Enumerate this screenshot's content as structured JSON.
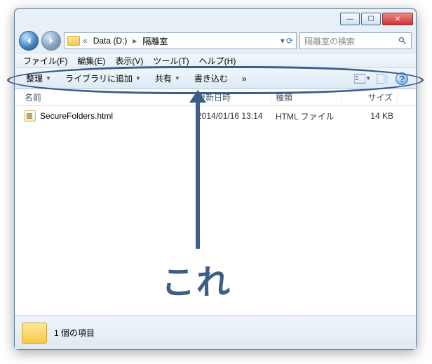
{
  "titlebar": {
    "min": "—",
    "max": "☐",
    "close": "✕"
  },
  "nav": {
    "back_icon": "◄",
    "fwd_icon": "►",
    "path_head": "«",
    "path_drive": "Data (D:)",
    "path_folder": "隔離室",
    "search_placeholder": "隔離室の検索"
  },
  "menu": {
    "file": "ファイル(F)",
    "edit": "編集(E)",
    "view": "表示(V)",
    "tools": "ツール(T)",
    "help": "ヘルプ(H)"
  },
  "toolbar": {
    "organize": "整理",
    "addlib": "ライブラリに追加",
    "share": "共有",
    "write": "書き込む",
    "more": "»"
  },
  "columns": {
    "name": "名前",
    "date": "更新日時",
    "type": "種類",
    "size": "サイズ"
  },
  "files": [
    {
      "name": "SecureFolders.html",
      "date": "2014/01/16 13:14",
      "type": "HTML ファイル",
      "size": "14 KB"
    }
  ],
  "status": {
    "count": "1 個の項目"
  },
  "annotation": {
    "label": "これ"
  }
}
